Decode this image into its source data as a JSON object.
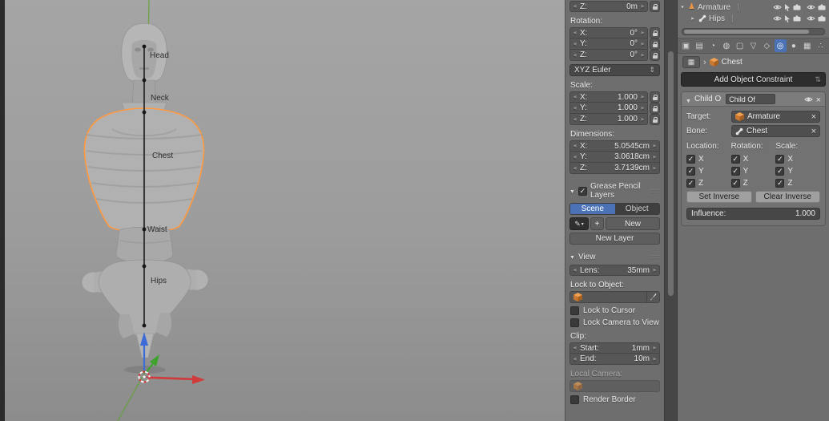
{
  "viewport": {
    "bone_labels": [
      {
        "label": "Head"
      },
      {
        "label": "Neck"
      },
      {
        "label": "Chest"
      },
      {
        "label": "Waist"
      },
      {
        "label": "Hips"
      }
    ]
  },
  "n_panel": {
    "loc_z": {
      "label": "Z:",
      "value": "0m"
    },
    "rotation_title": "Rotation:",
    "rot_x": {
      "label": "X:",
      "value": "0°"
    },
    "rot_y": {
      "label": "Y:",
      "value": "0°"
    },
    "rot_z": {
      "label": "Z:",
      "value": "0°"
    },
    "rotation_mode": "XYZ Euler",
    "scale_title": "Scale:",
    "scale_x": {
      "label": "X:",
      "value": "1.000"
    },
    "scale_y": {
      "label": "Y:",
      "value": "1.000"
    },
    "scale_z": {
      "label": "Z:",
      "value": "1.000"
    },
    "dimensions_title": "Dimensions:",
    "dim_x": {
      "label": "X:",
      "value": "5.0545cm"
    },
    "dim_y": {
      "label": "Y:",
      "value": "3.0618cm"
    },
    "dim_z": {
      "label": "Z:",
      "value": "3.7139cm"
    },
    "grease": {
      "title": "Grease Pencil Layers",
      "checked": true,
      "tab_scene": "Scene",
      "tab_object": "Object",
      "active_tab": "Scene",
      "new_button": "New",
      "new_layer_button": "New Layer"
    },
    "view": {
      "title": "View",
      "lens_label": "Lens:",
      "lens_value": "35mm",
      "lock_to_object_label": "Lock to Object:",
      "lock_to_cursor_label": "Lock to Cursor",
      "lock_to_cursor_checked": false,
      "lock_camera_label": "Lock Camera to View",
      "lock_camera_checked": false,
      "clip_label": "Clip:",
      "clip_start_label": "Start:",
      "clip_start_value": "1mm",
      "clip_end_label": "End:",
      "clip_end_value": "10m",
      "local_camera_label": "Local Camera:",
      "render_border_label": "Render Border",
      "render_border_checked": false
    }
  },
  "outliner": {
    "items": [
      {
        "label": "Armature"
      },
      {
        "label": "Hips"
      }
    ]
  },
  "properties": {
    "tabs": [
      {
        "name": "render",
        "glyph": "▣"
      },
      {
        "name": "render-layers",
        "glyph": "▤"
      },
      {
        "name": "scene",
        "glyph": "◔"
      },
      {
        "name": "world",
        "glyph": "◍"
      },
      {
        "name": "object",
        "glyph": "▢"
      },
      {
        "name": "object-data",
        "glyph": "▽"
      },
      {
        "name": "modifiers",
        "glyph": "◇"
      },
      {
        "name": "constraints",
        "glyph": "◎",
        "active": true
      },
      {
        "name": "material",
        "glyph": "●"
      },
      {
        "name": "texture",
        "glyph": "▦"
      },
      {
        "name": "physics",
        "glyph": "∴"
      }
    ],
    "breadcrumb": {
      "object": "Chest"
    },
    "add_constraint_label": "Add Object Constraint",
    "constraint": {
      "panel_title": "Child O",
      "name_value": "Child Of",
      "target_label": "Target:",
      "target_value": "Armature",
      "bone_label": "Bone:",
      "bone_value": "Chest",
      "col_location": "Location:",
      "col_rotation": "Rotation:",
      "col_scale": "Scale:",
      "axis_x": "X",
      "axis_y": "Y",
      "axis_z": "Z",
      "checks": {
        "location": [
          true,
          true,
          true
        ],
        "rotation": [
          true,
          true,
          true
        ],
        "scale": [
          true,
          true,
          true
        ]
      },
      "set_inverse_label": "Set Inverse",
      "clear_inverse_label": "Clear Inverse",
      "influence_label": "Influence:",
      "influence_value": "1.000"
    }
  },
  "colors": {
    "accent_blue": "#4a72b5",
    "selection_orange": "#ff9a40",
    "axis_red": "#d03c3c",
    "axis_green": "#3fa32e",
    "axis_blue": "#3d6bd8"
  }
}
